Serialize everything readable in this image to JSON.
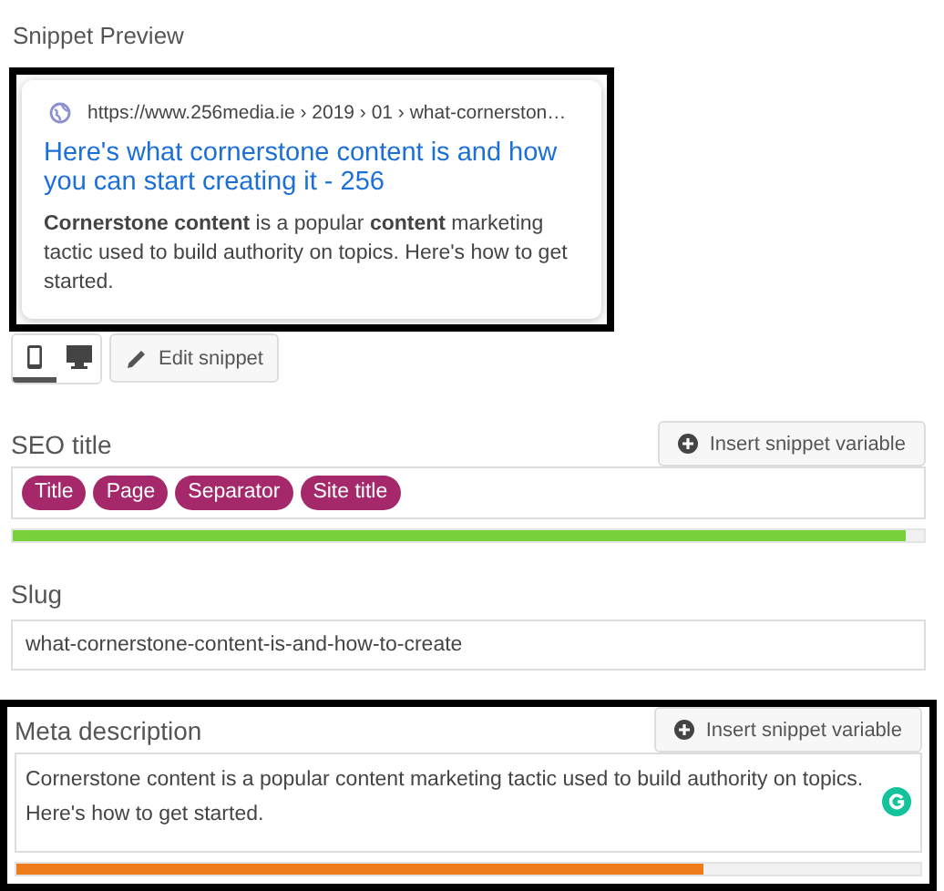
{
  "heading": "Snippet Preview",
  "preview": {
    "highlighted": true,
    "url": "https://www.256media.ie › 2019 › 01 › what-cornerston…",
    "title": "Here's what cornerstone content is and how you can start creating it - 256",
    "description": "**Cornerstone content** is a popular **content** marketing tactic used to build authority on topics. Here's how to get started."
  },
  "modes": [
    {
      "kind": "mobile",
      "selected": true
    },
    {
      "kind": "desktop",
      "selected": false
    }
  ],
  "edit_button": "Edit snippet",
  "fields": [
    {
      "kind": "tags",
      "label": "SEO title",
      "insert_button": "Insert snippet variable",
      "highlighted": false,
      "tags": [
        "Title",
        "Page",
        "Separator",
        "Site title"
      ],
      "level": 0.98,
      "color": "#7ad03a"
    },
    {
      "kind": "text",
      "label": "Slug",
      "highlighted": false,
      "value": "what-cornerstone-content-is-and-how-to-create"
    },
    {
      "kind": "textarea",
      "label": "Meta description",
      "insert_button": "Insert snippet variable",
      "highlighted": true,
      "value": "Cornerstone content is a popular content marketing tactic used to build authority on topics. Here's how to get started.",
      "level": 0.76,
      "color": "#ee7c1b"
    }
  ]
}
